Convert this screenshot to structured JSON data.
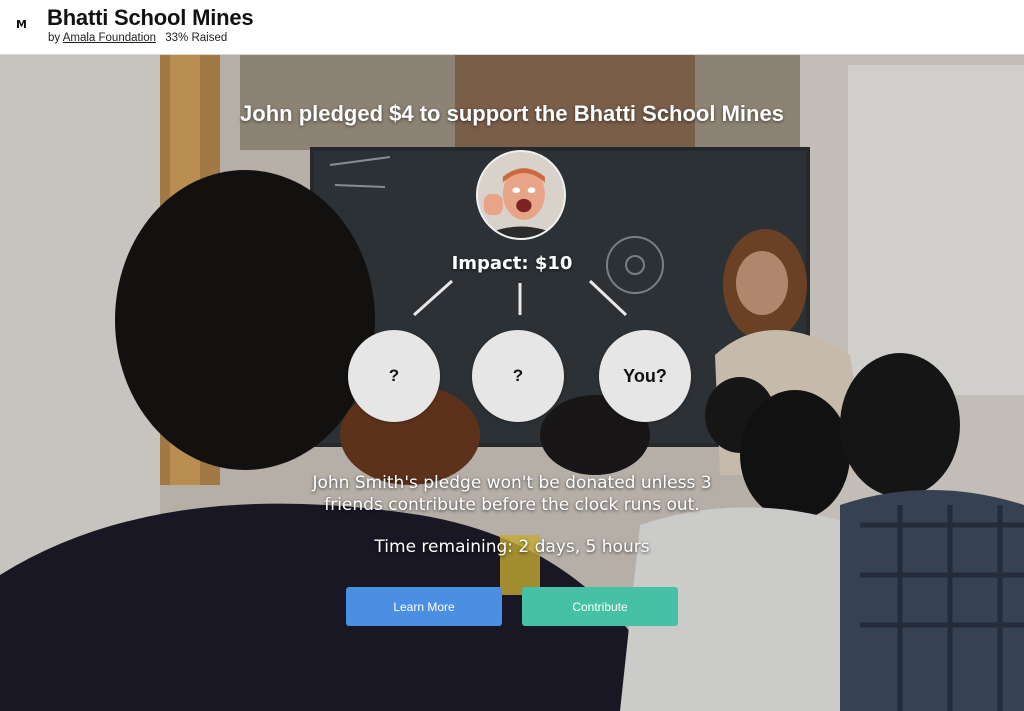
{
  "header": {
    "logo": "M",
    "title": "Bhatti School Mines",
    "by_prefix": "by",
    "organization": "Amala Foundation",
    "raised": "33% Raised"
  },
  "hero": {
    "headline": "John pledged $4 to support the Bhatti School Mines",
    "impact": "Impact: $10",
    "friends": [
      "?",
      "?",
      "You?"
    ],
    "message_line1": "John Smith's pledge won't be donated unless 3",
    "message_line2": "friends contribute before the clock runs out.",
    "time_remaining": "Time remaining: 2 days, 5 hours"
  },
  "actions": {
    "learn_more": "Learn More",
    "contribute": "Contribute"
  },
  "colors": {
    "learn_more": "#4a8fe2",
    "contribute": "#45c2a6",
    "friend_circle": "#e6e6e6"
  }
}
